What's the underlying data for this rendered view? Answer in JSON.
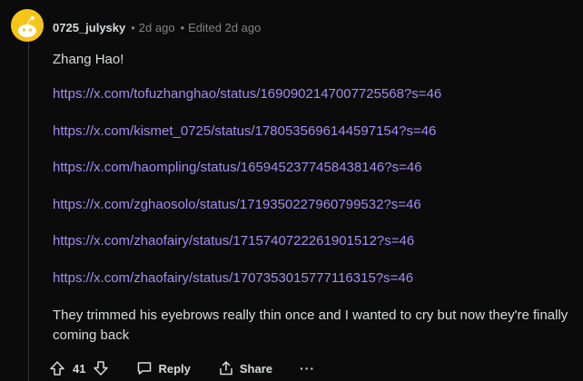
{
  "comment": {
    "username": "0725_julysky",
    "time": "2d ago",
    "edited": "Edited 2d ago",
    "paragraphs": {
      "intro": "Zhang Hao!",
      "closing": "They trimmed his eyebrows really thin once and I wanted to cry but now they're finally coming back"
    },
    "links": [
      "https://x.com/tofuzhanghao/status/1690902147007725568?s=46",
      "https://x.com/kismet_0725/status/1780535696144597154?s=46",
      "https://x.com/haompling/status/1659452377458438146?s=46",
      "https://x.com/zghaosolo/status/1719350227960799532?s=46",
      "https://x.com/zhaofairy/status/1715740722261901512?s=46",
      "https://x.com/zhaofairy/status/1707353015777116315?s=46"
    ]
  },
  "actions": {
    "vote_count": "41",
    "reply_label": "Reply",
    "share_label": "Share",
    "more_label": "···"
  },
  "colors": {
    "background": "#0b0b0b",
    "text": "#d7dadc",
    "meta": "#818384",
    "link": "#a48cf0",
    "avatar": "#f5c518"
  },
  "icons": {
    "avatar": "snoo-avatar-icon",
    "upvote": "upvote-arrow-icon",
    "downvote": "downvote-arrow-icon",
    "reply": "speech-bubble-icon",
    "share": "share-icon",
    "more": "more-dots-icon"
  }
}
